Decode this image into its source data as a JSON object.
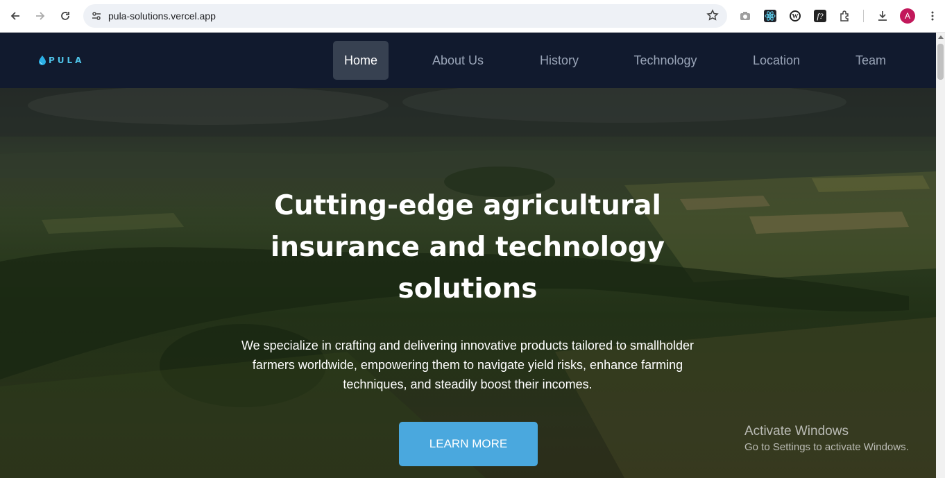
{
  "browser": {
    "url": "pula-solutions.vercel.app",
    "profile_initial": "A",
    "icons": [
      "back-icon",
      "forward-icon",
      "reload-icon",
      "site-settings-icon",
      "bookmark-star-icon",
      "screenshot-camera-icon",
      "react-devtools-icon",
      "wordpress-icon",
      "font-ext-icon",
      "extensions-puzzle-icon",
      "download-icon",
      "more-menu-icon"
    ]
  },
  "site": {
    "logo_text": "PULA",
    "nav": [
      {
        "label": "Home",
        "active": true
      },
      {
        "label": "About Us",
        "active": false
      },
      {
        "label": "History",
        "active": false
      },
      {
        "label": "Technology",
        "active": false
      },
      {
        "label": "Location",
        "active": false
      },
      {
        "label": "Team",
        "active": false
      }
    ]
  },
  "hero": {
    "title": "Cutting-edge agricultural insurance and technology solutions",
    "subtitle": "We specialize in crafting and delivering innovative products tailored to smallholder farmers worldwide, empowering them to navigate yield risks, enhance farming techniques, and steadily boost their incomes.",
    "cta_label": "LEARN MORE"
  },
  "watermark": {
    "line1": "Activate Windows",
    "line2": "Go to Settings to activate Windows."
  },
  "colors": {
    "nav_bg": "#111a2e",
    "nav_active_bg": "#374151",
    "cta_bg": "#4aa8de",
    "logo_accent": "#4fc3e8"
  }
}
